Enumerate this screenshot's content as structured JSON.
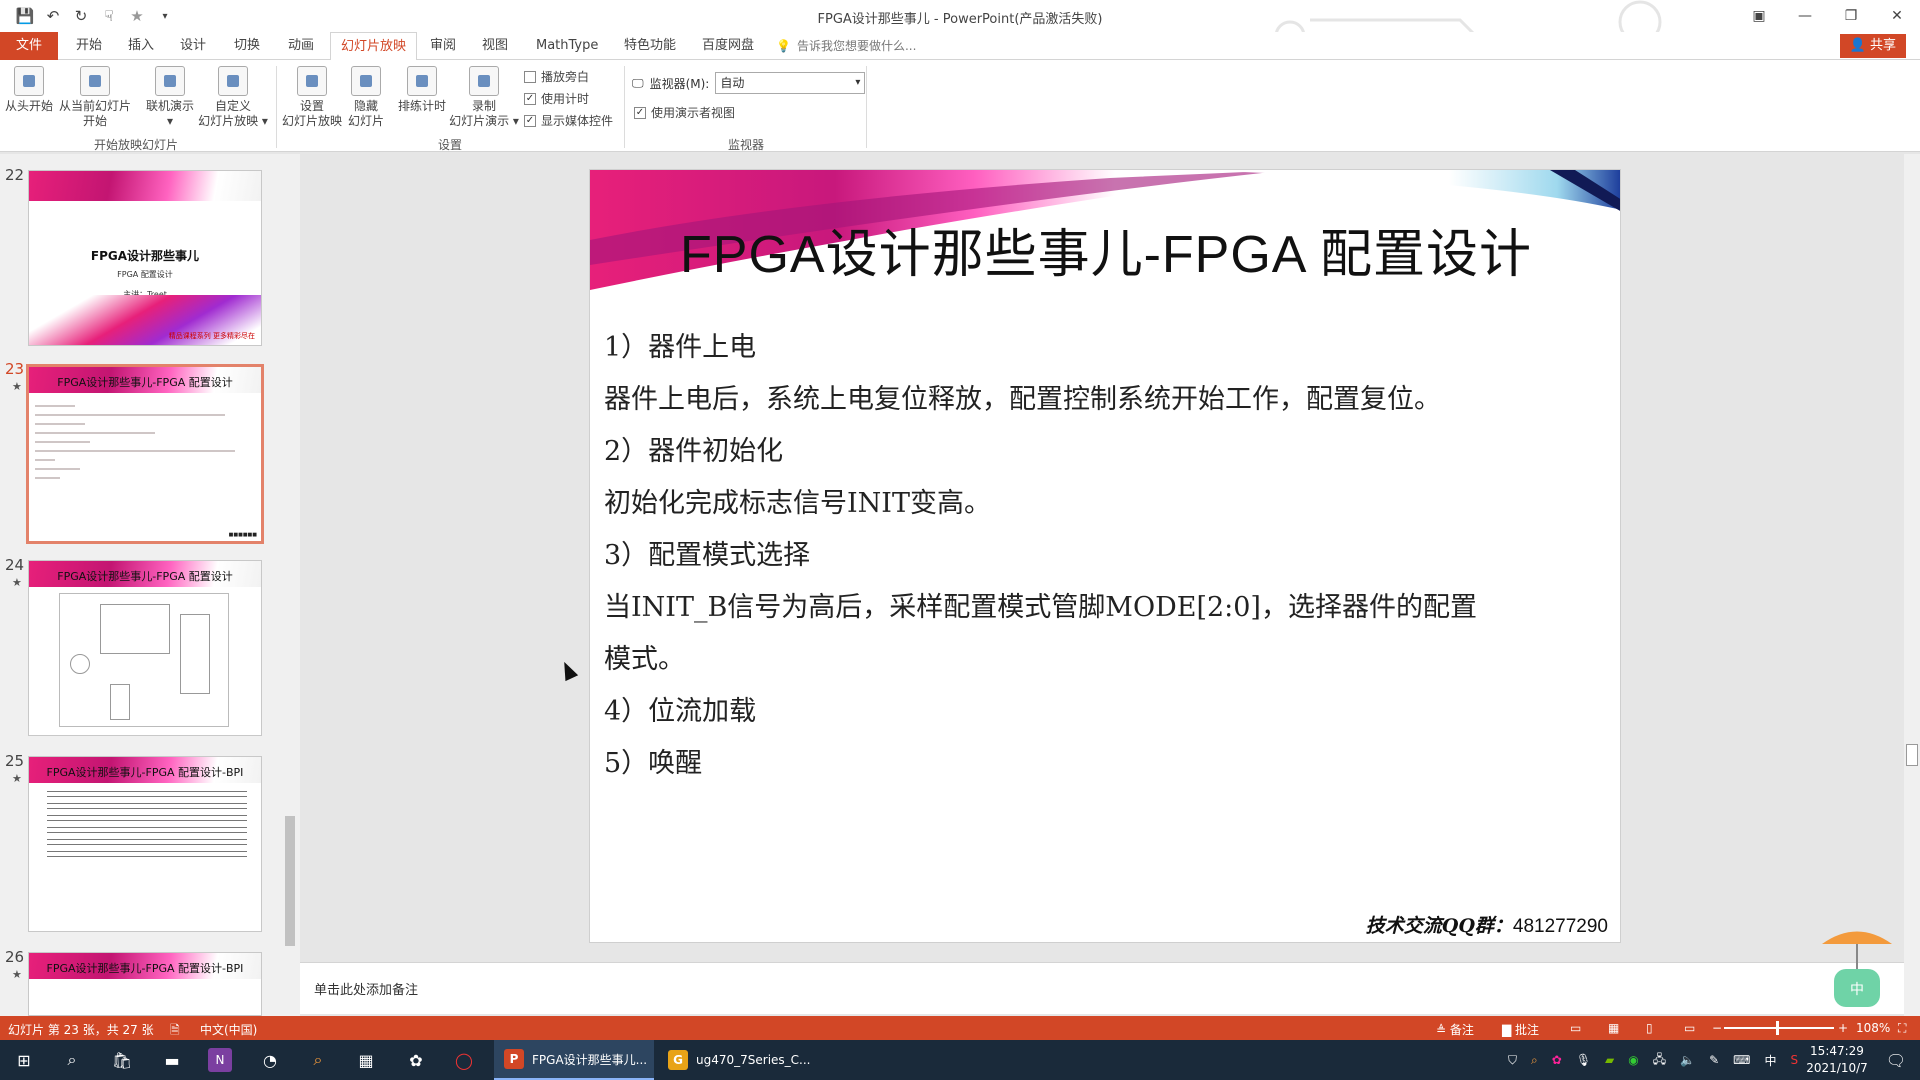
{
  "window": {
    "title": "FPGA设计那些事儿 - PowerPoint(产品激活失败)",
    "controls": {
      "ribbon_display": "▣",
      "minimize": "—",
      "restore": "❐",
      "close": "✕"
    }
  },
  "quick_access": {
    "save": "💾",
    "undo": "↶",
    "redo": "↻",
    "touch": "☟",
    "star": "★",
    "more": "▾"
  },
  "tabs": [
    "文件",
    "开始",
    "插入",
    "设计",
    "切换",
    "动画",
    "幻灯片放映",
    "审阅",
    "视图",
    "MathType",
    "特色功能",
    "百度网盘"
  ],
  "active_tab": "幻灯片放映",
  "tell_me": {
    "icon": "lightbulb-icon",
    "placeholder": "告诉我您想要做什么..."
  },
  "share_label": "共享",
  "ribbon": {
    "start_group": {
      "label": "开始放映幻灯片",
      "from_beginning": "从头开始",
      "from_current_1": "从当前幻灯片",
      "from_current_2": "开始",
      "online_1": "联机演示",
      "online_2": "▾",
      "custom_1": "自定义",
      "custom_2": "幻灯片放映 ▾"
    },
    "setup_group": {
      "label": "设置",
      "setup_1": "设置",
      "setup_2": "幻灯片放映",
      "hide_1": "隐藏",
      "hide_2": "幻灯片",
      "rehearse": "排练计时",
      "record_1": "录制",
      "record_2": "幻灯片演示 ▾",
      "chk_narration": "播放旁白",
      "chk_timings": "使用计时",
      "chk_media": "显示媒体控件"
    },
    "monitor_group": {
      "label": "监视器",
      "monitor_label": "监视器(M):",
      "monitor_value": "自动",
      "presenter_view": "使用演示者视图"
    }
  },
  "thumbnails": [
    {
      "num": "22",
      "star": "",
      "title": "FPGA设计那些事儿",
      "subtitle": "FPGA 配置设计",
      "speaker": "主讲：Treet",
      "brand": "精品课程系列 更多精彩尽在"
    },
    {
      "num": "23",
      "star": "★",
      "title": "FPGA设计那些事儿-FPGA 配置设计"
    },
    {
      "num": "24",
      "star": "★",
      "title": "FPGA设计那些事儿-FPGA 配置设计"
    },
    {
      "num": "25",
      "star": "★",
      "title": "FPGA设计那些事儿-FPGA 配置设计-BPI"
    },
    {
      "num": "26",
      "star": "★",
      "title": "FPGA设计那些事儿-FPGA 配置设计-BPI"
    }
  ],
  "slide": {
    "title": "FPGA设计那些事儿-FPGA 配置设计",
    "lines": [
      "1）器件上电",
      "器件上电后，系统上电复位释放，配置控制系统开始工作，配置复位。",
      "2）器件初始化",
      "初始化完成标志信号INIT变高。",
      "3）配置模式选择",
      "当INIT_B信号为高后，采样配置模式管脚MODE[2:0]，选择器件的配置",
      "模式。",
      "4）位流加载",
      "5）唤醒"
    ],
    "qq_label": "技术交流QQ群：",
    "qq_number": "481277290"
  },
  "notes_placeholder": "单击此处添加备注",
  "status": {
    "slide_info": "幻灯片 第 23 张，共 27 张",
    "language": "中文(中国)",
    "notes": "≜ 备注",
    "comments": "▇ 批注",
    "zoom": "108%"
  },
  "taskbar": {
    "apps": [
      {
        "label": "FPGA设计那些事儿...",
        "icon": "P",
        "color": "#d24726"
      },
      {
        "label": "ug470_7Series_C...",
        "icon": "G",
        "color": "#e8a317"
      }
    ],
    "ime": "中",
    "time": "15:47:29",
    "date": "2021/10/7",
    "notif": "1"
  },
  "colors": {
    "accent": "#d24726",
    "taskbar": "#1a2a3a",
    "slide_banner": "#e7207a"
  }
}
